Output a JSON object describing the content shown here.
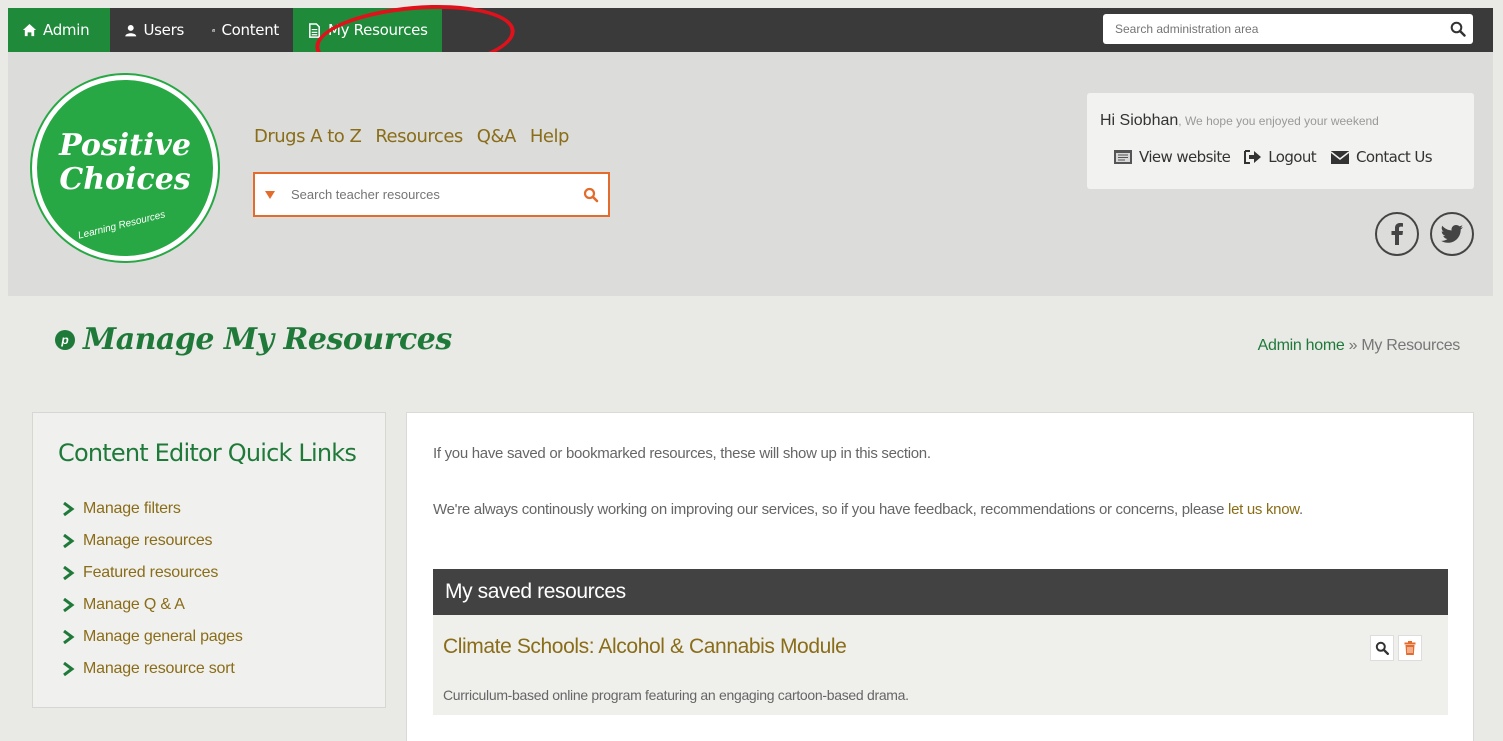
{
  "topbar": {
    "tabs": [
      {
        "label": "Admin",
        "icon": "home-icon",
        "active": true
      },
      {
        "label": "Users",
        "icon": "user-icon",
        "active": false
      },
      {
        "label": "Content",
        "icon": "content-icon",
        "active": false
      },
      {
        "label": "My Resources",
        "icon": "document-icon",
        "active": true
      }
    ],
    "search_placeholder": "Search administration area"
  },
  "header": {
    "logo": {
      "line1": "Positive",
      "line2": "Choices",
      "tagline": "Learning Resources"
    },
    "nav": [
      "Drugs A to Z",
      "Resources",
      "Q&A",
      "Help"
    ],
    "search_placeholder": "Search teacher resources",
    "user": {
      "name": "Hi Siobhan",
      "message": ", We hope you enjoyed your weekend",
      "links": [
        {
          "label": "View website",
          "icon": "monitor-icon"
        },
        {
          "label": "Logout",
          "icon": "logout-icon"
        },
        {
          "label": "Contact Us",
          "icon": "envelope-icon"
        }
      ]
    },
    "social": [
      "facebook-icon",
      "twitter-icon"
    ]
  },
  "page": {
    "title": "Manage My Resources",
    "breadcrumb_home": "Admin home",
    "breadcrumb_sep": " » ",
    "breadcrumb_current": "My Resources"
  },
  "sidebar": {
    "title": "Content Editor Quick Links",
    "items": [
      "Manage filters",
      "Manage resources",
      "Featured resources",
      "Manage Q & A",
      "Manage general pages",
      "Manage resource sort"
    ]
  },
  "main": {
    "intro1": "If you have saved or bookmarked resources, these will show up in this section.",
    "intro2": "We're always continously working on improving our services, so if you have feedback, recommendations or concerns, please ",
    "intro2_link": "let us know",
    "intro2_end": ".",
    "saved_heading": "My saved resources",
    "resources": [
      {
        "title": "Climate Schools: Alcohol & Cannabis Module",
        "description": "Curriculum-based online program featuring an engaging cartoon-based drama."
      }
    ]
  },
  "colors": {
    "brand_green": "#1f7a3a",
    "active_tab": "#1f8a3a",
    "link_gold": "#8a6d18",
    "search_orange": "#e36b2c",
    "annotation_red": "#e1111b"
  }
}
